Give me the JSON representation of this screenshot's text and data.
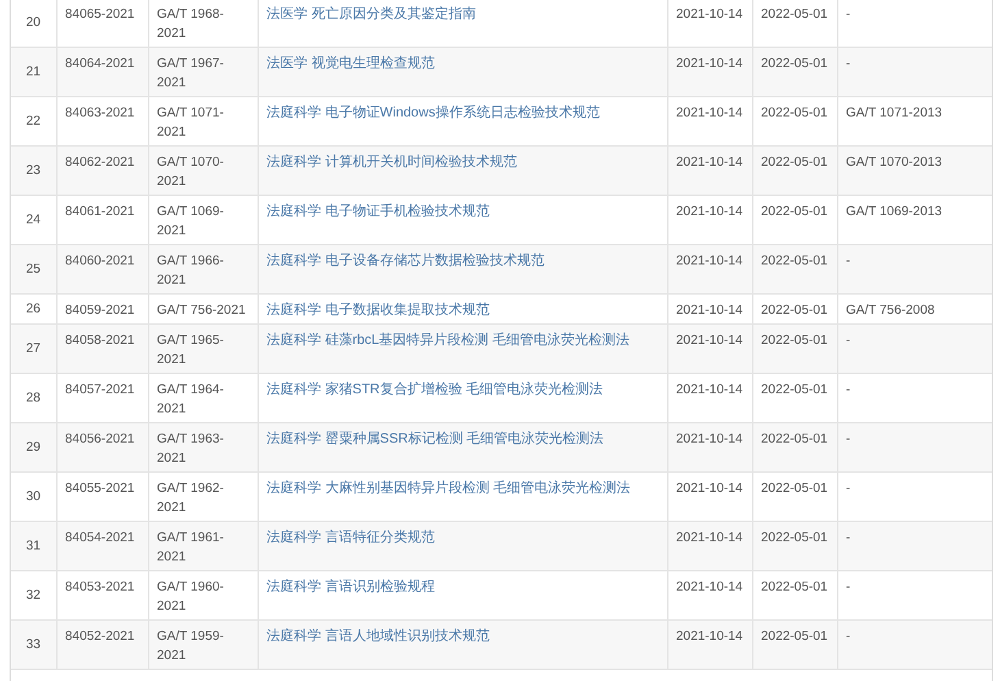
{
  "table": {
    "columns": [
      {
        "kind": "number"
      },
      {
        "kind": "text"
      },
      {
        "kind": "text"
      },
      {
        "kind": "link"
      },
      {
        "kind": "text"
      },
      {
        "kind": "text"
      },
      {
        "kind": "text"
      }
    ],
    "rows": [
      {
        "cells": [
          "20",
          "84065-2021",
          "GA/T 1968-2021",
          "法医学 死亡原因分类及其鉴定指南",
          "2021-10-14",
          "2022-05-01",
          "-"
        ]
      },
      {
        "cells": [
          "21",
          "84064-2021",
          "GA/T 1967-2021",
          "法医学 视觉电生理检查规范",
          "2021-10-14",
          "2022-05-01",
          "-"
        ]
      },
      {
        "cells": [
          "22",
          "84063-2021",
          "GA/T 1071-2021",
          "法庭科学 电子物证Windows操作系统日志检验技术规范",
          "2021-10-14",
          "2022-05-01",
          "GA/T 1071-2013"
        ]
      },
      {
        "cells": [
          "23",
          "84062-2021",
          "GA/T 1070-2021",
          "法庭科学 计算机开关机时间检验技术规范",
          "2021-10-14",
          "2022-05-01",
          "GA/T 1070-2013"
        ]
      },
      {
        "cells": [
          "24",
          "84061-2021",
          "GA/T 1069-2021",
          "法庭科学 电子物证手机检验技术规范",
          "2021-10-14",
          "2022-05-01",
          "GA/T 1069-2013"
        ]
      },
      {
        "cells": [
          "25",
          "84060-2021",
          "GA/T 1966-2021",
          "法庭科学 电子设备存储芯片数据检验技术规范",
          "2021-10-14",
          "2022-05-01",
          "-"
        ]
      },
      {
        "cells": [
          "26",
          "84059-2021",
          "GA/T 756-2021",
          "法庭科学 电子数据收集提取技术规范",
          "2021-10-14",
          "2022-05-01",
          "GA/T 756-2008"
        ]
      },
      {
        "cells": [
          "27",
          "84058-2021",
          "GA/T 1965-2021",
          "法庭科学 硅藻rbcL基因特异片段检测 毛细管电泳荧光检测法",
          "2021-10-14",
          "2022-05-01",
          "-"
        ]
      },
      {
        "cells": [
          "28",
          "84057-2021",
          "GA/T 1964-2021",
          "法庭科学 家猪STR复合扩增检验 毛细管电泳荧光检测法",
          "2021-10-14",
          "2022-05-01",
          "-"
        ]
      },
      {
        "cells": [
          "29",
          "84056-2021",
          "GA/T 1963-2021",
          "法庭科学 罂粟种属SSR标记检测 毛细管电泳荧光检测法",
          "2021-10-14",
          "2022-05-01",
          "-"
        ]
      },
      {
        "cells": [
          "30",
          "84055-2021",
          "GA/T 1962-2021",
          "法庭科学 大麻性别基因特异片段检测 毛细管电泳荧光检测法",
          "2021-10-14",
          "2022-05-01",
          "-"
        ]
      },
      {
        "cells": [
          "31",
          "84054-2021",
          "GA/T 1961-2021",
          "法庭科学 言语特征分类规范",
          "2021-10-14",
          "2022-05-01",
          "-"
        ]
      },
      {
        "cells": [
          "32",
          "84053-2021",
          "GA/T 1960-2021",
          "法庭科学 言语识别检验规程",
          "2021-10-14",
          "2022-05-01",
          "-"
        ]
      },
      {
        "cells": [
          "33",
          "84052-2021",
          "GA/T 1959-2021",
          "法庭科学 言语人地域性识别技术规范",
          "2021-10-14",
          "2022-05-01",
          "-"
        ]
      }
    ]
  }
}
